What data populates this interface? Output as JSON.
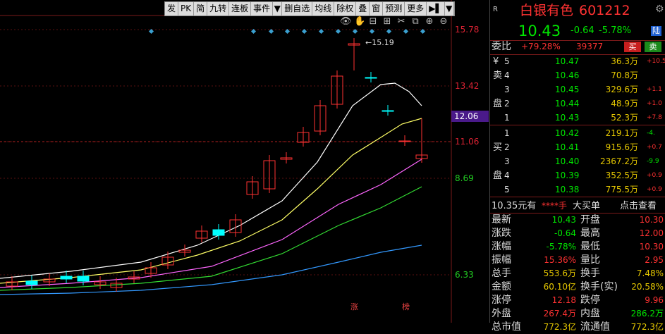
{
  "toolbar": {
    "items": [
      "发",
      "PK",
      "简",
      "九转",
      "连板",
      "事件",
      "▼",
      "删自选",
      "均线",
      "除权",
      "叠",
      "窗",
      "预测",
      "更多",
      "▶▌",
      "▼"
    ]
  },
  "chart": {
    "price_labels": [
      "15.78",
      "13.42",
      "11.06",
      "8.69",
      "6.33"
    ],
    "current_price_tag": "12.06",
    "high_annotation": "15.19",
    "bottom_marks": [
      "涨",
      "榜"
    ],
    "ctrl_icons": [
      "eye-icon",
      "hand-icon",
      "zoom-out-icon",
      "zoom-in-icon",
      "scissors-icon",
      "copy-icon",
      "plus-circle-icon",
      "minus-circle-icon"
    ],
    "colors": {
      "up": "#ff3232",
      "down": "#00ffff",
      "ma5": "#ffffff",
      "ma10": "#ffff66",
      "ma20": "#ff66ff",
      "ma30": "#33dd33",
      "ma60": "#3399ff"
    }
  },
  "quote": {
    "label_r": "R",
    "name": "白银有色",
    "code": "601212",
    "price": "10.43",
    "change": "-0.64",
    "change_pct": "-5.78%",
    "board_badge": "陆",
    "webi_label": "委比",
    "webi_value": "+79.28%",
    "webi_diff": "39377",
    "buy_btn": "买",
    "sell_btn": "卖",
    "sell_side_label": [
      "¥",
      "卖",
      "",
      "盘",
      ""
    ],
    "buy_side_label": [
      "",
      "买",
      "",
      "盘",
      ""
    ],
    "asks": [
      {
        "lvl": "5",
        "price": "10.47",
        "vol": "36.3万",
        "chg": "+10.5"
      },
      {
        "lvl": "4",
        "price": "10.46",
        "vol": "70.8万",
        "chg": ""
      },
      {
        "lvl": "3",
        "price": "10.45",
        "vol": "329.6万",
        "chg": "+1.1"
      },
      {
        "lvl": "2",
        "price": "10.44",
        "vol": "48.9万",
        "chg": "+1.0"
      },
      {
        "lvl": "1",
        "price": "10.43",
        "vol": "52.3万",
        "chg": "+7.8"
      }
    ],
    "bids": [
      {
        "lvl": "1",
        "price": "10.42",
        "vol": "219.1万",
        "chg": "-4."
      },
      {
        "lvl": "2",
        "price": "10.41",
        "vol": "915.6万",
        "chg": "+0.7"
      },
      {
        "lvl": "3",
        "price": "10.40",
        "vol": "2367.2万",
        "chg": "-9.9"
      },
      {
        "lvl": "4",
        "price": "10.39",
        "vol": "352.5万",
        "chg": "+0.9"
      },
      {
        "lvl": "5",
        "price": "10.38",
        "vol": "775.5万",
        "chg": "+0.9"
      }
    ],
    "bigorder": {
      "left": "10.35元有",
      "stars": "****手",
      "mid": "大买单",
      "right": "点击查看"
    },
    "stats": [
      {
        "l1": "最新",
        "v1": "10.43",
        "l2": "开盘",
        "v2": "10.30"
      },
      {
        "l1": "涨跌",
        "v1": "-0.64",
        "l2": "最高",
        "v2": "12.00"
      },
      {
        "l1": "涨幅",
        "v1": "-5.78%",
        "l2": "最低",
        "v2": "10.30"
      },
      {
        "l1": "振幅",
        "v1": "15.36%",
        "l2": "量比",
        "v2": "2.95"
      },
      {
        "l1": "总手",
        "v1": "553.6万",
        "l2": "换手",
        "v2": "7.48%"
      },
      {
        "l1": "金额",
        "v1": "60.10亿",
        "l2": "换手(实)",
        "v2": "20.58%"
      },
      {
        "l1": "涨停",
        "v1": "12.18",
        "l2": "跌停",
        "v2": "9.96"
      },
      {
        "l1": "外盘",
        "v1": "267.4万",
        "l2": "内盘",
        "v2": "286.2万"
      },
      {
        "l1": "总市值",
        "v1": "772.3亿",
        "l2": "流通值",
        "v2": "772.3亿"
      }
    ]
  }
}
